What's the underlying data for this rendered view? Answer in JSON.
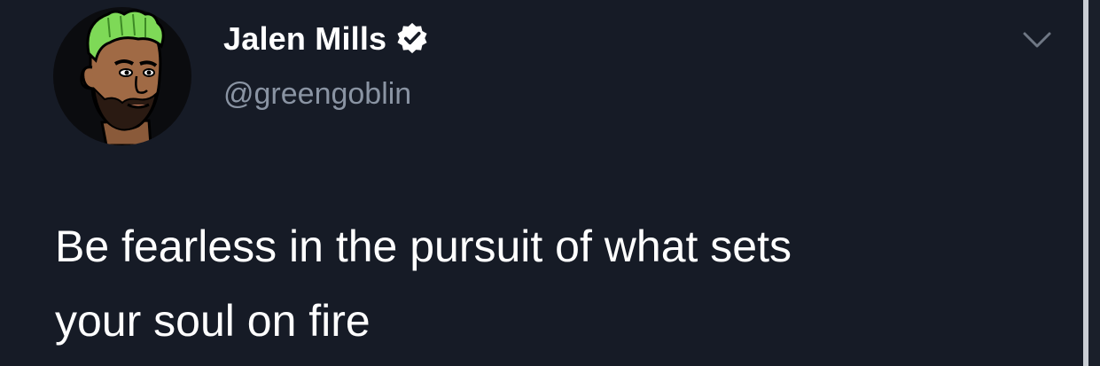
{
  "tweet": {
    "display_name": "Jalen Mills",
    "handle": "@greengoblin",
    "text_line1": "Be fearless in the pursuit of what sets",
    "text_line2": "your soul on fire",
    "verified": true
  },
  "icons": {
    "verified": "verified-badge-icon",
    "menu": "chevron-down-icon",
    "avatar": "cartoon-avatar-green-hair"
  },
  "colors": {
    "background": "#161b26",
    "name": "#ffffff",
    "handle": "#8a94a3",
    "text": "#ffffff",
    "hair": "#7ed957"
  }
}
